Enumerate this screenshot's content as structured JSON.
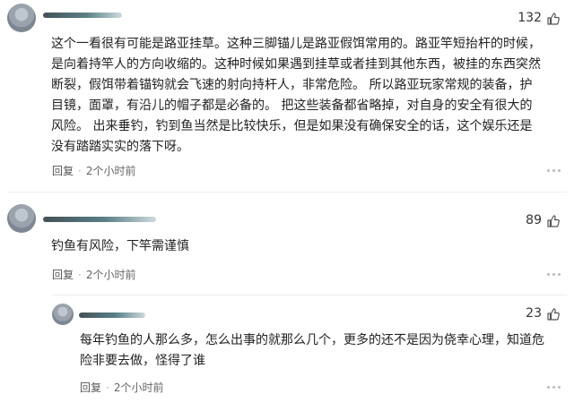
{
  "comments": [
    {
      "likes": "132",
      "text": "这个一看很有可能是路亚挂草。这种三脚锚儿是路亚假饵常用的。路亚竿短抬杆的时候，\n是向着持竿人的方向收缩的。这种时候如果遇到挂草或者挂到其他东西，被挂的东西突然\n断裂，假饵带着锚钩就会飞速的射向持杆人，非常危险。 所以路亚玩家常规的装备，护\n目镜，面罩，有沿儿的帽子都是必备的。 把这些装备都省略掉，对自身的安全有很大的\n风险。 出来垂钓，钓到鱼当然是比较快乐，但是如果没有确保安全的话，这个娱乐还是\n没有踏踏实实的落下呀。",
      "reply_label": "回复",
      "time": "2个小时前"
    },
    {
      "likes": "89",
      "text": "钓鱼有风险，下竿需谨慎",
      "reply_label": "回复",
      "time": "2个小时前"
    },
    {
      "likes": "23",
      "text": "每年钓鱼的人那么多，怎么出事的就那么几个，更多的还不是因为侥幸心理，知道危\n险非要去做，怪得了谁",
      "reply_label": "回复",
      "time": "2个小时前"
    }
  ],
  "icons": {
    "like": "thumbs-up-icon",
    "more": "more-options-icon"
  }
}
